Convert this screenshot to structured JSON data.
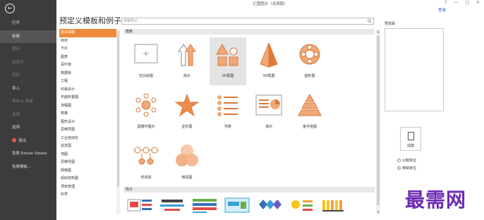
{
  "window": {
    "title": "亿图图示（试用版）",
    "login_label": "登录",
    "controls": [
      "?",
      "—",
      "□",
      "✕"
    ]
  },
  "sidebar": {
    "items": [
      {
        "label": "打开",
        "state": "normal"
      },
      {
        "label": "新建",
        "state": "active"
      },
      {
        "label": "保存",
        "state": "dim"
      },
      {
        "label": "另存为",
        "state": "dim"
      },
      {
        "label": "打印",
        "state": "dim"
      },
      {
        "label": "导入",
        "state": "normal"
      },
      {
        "label": "导出 & 发送",
        "state": "dim"
      },
      {
        "label": "关闭",
        "state": "dim"
      },
      {
        "label": "选项",
        "state": "normal"
      },
      {
        "label": "退出",
        "state": "normal"
      },
      {
        "label": "免费 Edraw Viewer",
        "state": "normal"
      },
      {
        "label": "免费模板...",
        "state": "normal"
      }
    ]
  },
  "page": {
    "title": "预定义模板和例子",
    "search_placeholder": "搜索例子..."
  },
  "categories": {
    "items": [
      "基本绘图",
      "商务",
      "卡片",
      "图表",
      "百叶窗",
      "数据库",
      "工程",
      "时装设计",
      "平面布置图",
      "流程图",
      "表格",
      "图形设计",
      "思维导图",
      "工业自动化",
      "信息图",
      "地图",
      "思维导图",
      "网络图",
      "组织结构图",
      "项目管理",
      "科学"
    ],
    "selected_index": 0
  },
  "sections": {
    "templates_label": "模板",
    "examples_label": "例子"
  },
  "templates": [
    {
      "label": "空白绘图",
      "icon": "blank-drawing-icon"
    },
    {
      "label": "箭头",
      "icon": "arrows-icon"
    },
    {
      "label": "2D框图",
      "icon": "2d-block-icon"
    },
    {
      "label": "3D框图",
      "icon": "3d-block-icon"
    },
    {
      "label": "圆形图",
      "icon": "circle-diagram-icon"
    },
    {
      "label": "圆循环图示",
      "icon": "circle-cycle-icon"
    },
    {
      "label": "星形图",
      "icon": "star-icon"
    },
    {
      "label": "列表",
      "icon": "list-icon"
    },
    {
      "label": "演示",
      "icon": "presentation-icon"
    },
    {
      "label": "金字塔图",
      "icon": "pyramid-icon"
    },
    {
      "label": "时间线",
      "icon": "timeline-icon"
    },
    {
      "label": "维恩图",
      "icon": "venn-icon"
    }
  ],
  "preview": {
    "label": "预览版",
    "create_label": "创建",
    "units": [
      {
        "label": "公制单位",
        "selected": false
      },
      {
        "label": "英制单位",
        "selected": true
      }
    ]
  },
  "colors": {
    "accent": "#ee8a3a",
    "sidebar_bg": "#3c3c3c",
    "icon_fill": "#f0a878",
    "icon_stroke": "#d9783c"
  },
  "watermark": "最需网"
}
